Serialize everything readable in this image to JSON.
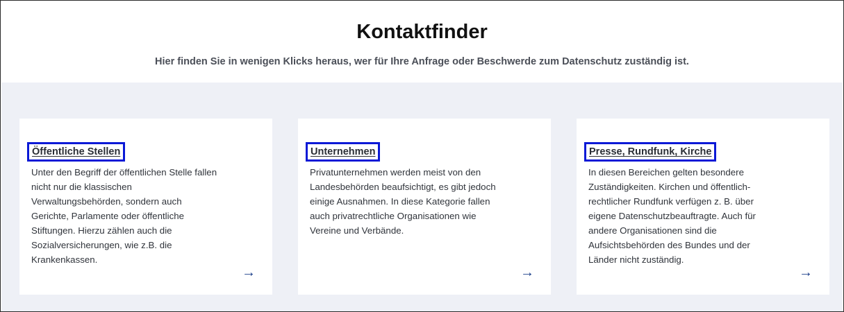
{
  "header": {
    "title": "Kontaktfinder",
    "subtitle": "Hier finden Sie in wenigen Klicks heraus, wer für Ihre Anfrage oder Beschwerde zum Datenschutz zuständig ist."
  },
  "cards": [
    {
      "title": "Öffentliche Stellen",
      "text": "Unter den Begriff der öffentlichen Stelle fallen nicht nur die klassischen Verwaltungsbehörden, sondern auch Gerichte, Parlamente oder öffentliche Stiftungen. Hierzu zählen auch die Sozialversicherungen, wie z.B. die Krankenkassen.",
      "arrow": "→"
    },
    {
      "title": "Unternehmen",
      "text": "Privatunternehmen werden meist von den Landesbehörden beaufsichtigt, es gibt jedoch einige Ausnahmen. In diese Kategorie fallen auch privatrechtliche Organisationen wie Vereine und Verbände.",
      "arrow": "→"
    },
    {
      "title": "Presse, Rundfunk, Kirche",
      "text": "In diesen Bereichen gelten besondere Zuständigkeiten. Kirchen und öffentlich-rechtlicher Rundfunk verfügen z. B. über eigene Datenschutzbeauftragte. Auch für andere Organisationen sind die Aufsichtsbehörden des Bundes und der Länder nicht zuständig.",
      "arrow": "→"
    }
  ],
  "colors": {
    "accent_arrow": "#1b3e8a",
    "highlight_box": "#0a19d6",
    "section_background": "#eef0f6"
  },
  "icons": {
    "card_arrow": "arrow-right-icon"
  }
}
